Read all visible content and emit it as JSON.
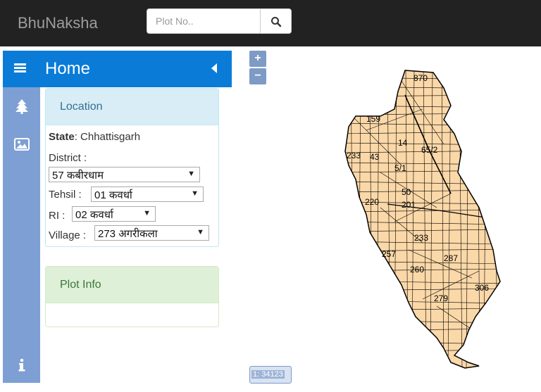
{
  "topbar": {
    "brand": "BhuNaksha",
    "search_placeholder": "Plot No.."
  },
  "panel": {
    "title": "Home"
  },
  "location": {
    "title": "Location",
    "state_label": "State",
    "state_value": ": Chhattisgarh",
    "district_label": "District :",
    "district_value": "57 कबीरधाम",
    "tehsil_label": "Tehsil :",
    "tehsil_value": "01 कवर्धा",
    "ri_label": "RI :",
    "ri_value": "02 कवर्धा",
    "village_label": "Village :",
    "village_value": "273 अगरीकला"
  },
  "plot_info": {
    "title": "Plot Info"
  },
  "map": {
    "zoom_in": "+",
    "zoom_out": "−",
    "scale": "1: 34123",
    "fill_color": "#fbd8a8",
    "plot_labels": [
      "870",
      "159",
      "14",
      "65/2",
      "233",
      "43",
      "5/1",
      "220",
      "201",
      "50",
      "287",
      "260",
      "233",
      "279",
      "306",
      "257"
    ]
  },
  "colors": {
    "topbar": "#222222",
    "header": "#0a7cd8",
    "iconbar": "#7d9fd3"
  }
}
